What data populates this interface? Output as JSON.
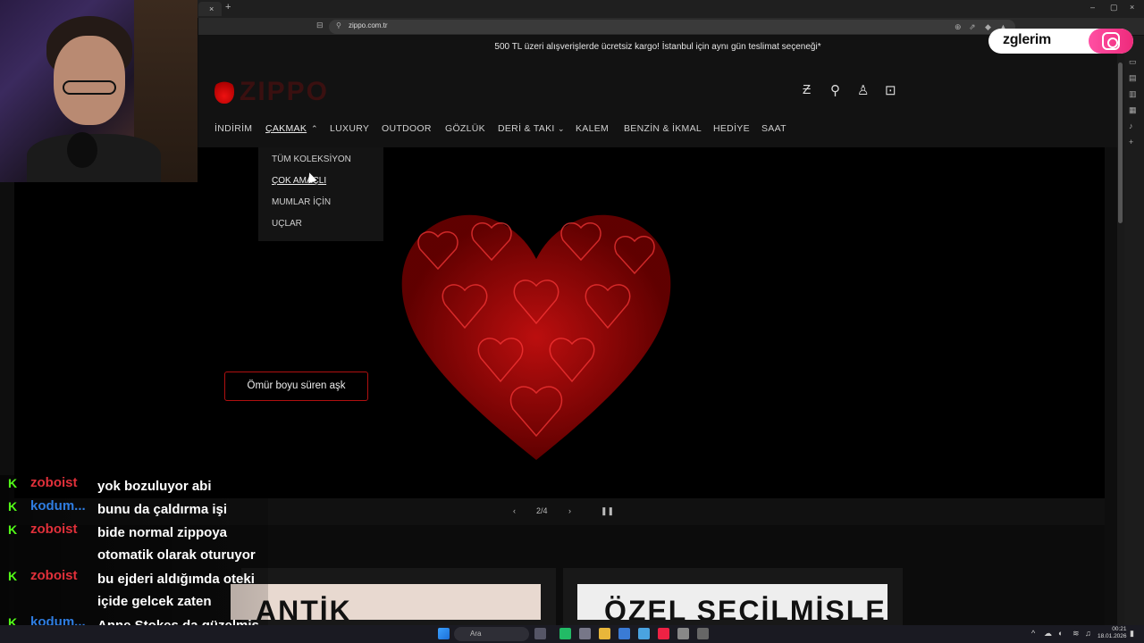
{
  "browser": {
    "tab_close": "×",
    "new_tab": "+",
    "url": "zippo.com.tr",
    "window_controls": [
      "–",
      "▢",
      "×"
    ]
  },
  "site": {
    "promo_text": "500 TL üzeri alışverişlerde ücretsiz kargo! İstanbul için aynı gün teslimat seçeneği*",
    "logo_text": "ZIPPO",
    "nav": [
      "İNDİRİM",
      "ÇAKMAK",
      "LUXURY",
      "OUTDOOR",
      "GÖZLÜK",
      "DERİ & TAKI",
      "KALEM",
      "BENZİN & İKMAL",
      "HEDİYE",
      "SAAT"
    ],
    "dropdown": [
      "TÜM KOLEKSİYON",
      "ÇOK AMAÇLI",
      "MUMLAR İÇİN",
      "UÇLAR"
    ],
    "hero_cta": "Ömür boyu süren aşk",
    "slider_counter": "2/4",
    "card1_title": "ANTİK",
    "card2_title": "ÖZEL SEÇİLMİŞLER"
  },
  "overlay": {
    "instagram_name": "zglerim",
    "chat": [
      {
        "user": "zoboist",
        "color": "#e0303a",
        "text": "yok bozuluyor abi"
      },
      {
        "user": "kodum...",
        "color": "#2f7de1",
        "text": "bunu da çaldırma işi"
      },
      {
        "user": "zoboist",
        "color": "#e0303a",
        "text": "bide normal zippoya"
      },
      {
        "user": "",
        "color": "#e0303a",
        "text": "otomatik olarak oturuyor"
      },
      {
        "user": "zoboist",
        "color": "#e0303a",
        "text": "bu ejderi aldığımda oteki"
      },
      {
        "user": "",
        "color": "#e0303a",
        "text": "içide gelcek zaten"
      },
      {
        "user": "kodum...",
        "color": "#2f7de1",
        "text": "Anne Stokes da güzelmiş"
      }
    ]
  },
  "taskbar": {
    "search_placeholder": "Ara",
    "time": "00:21",
    "date": "18.01.2026"
  }
}
